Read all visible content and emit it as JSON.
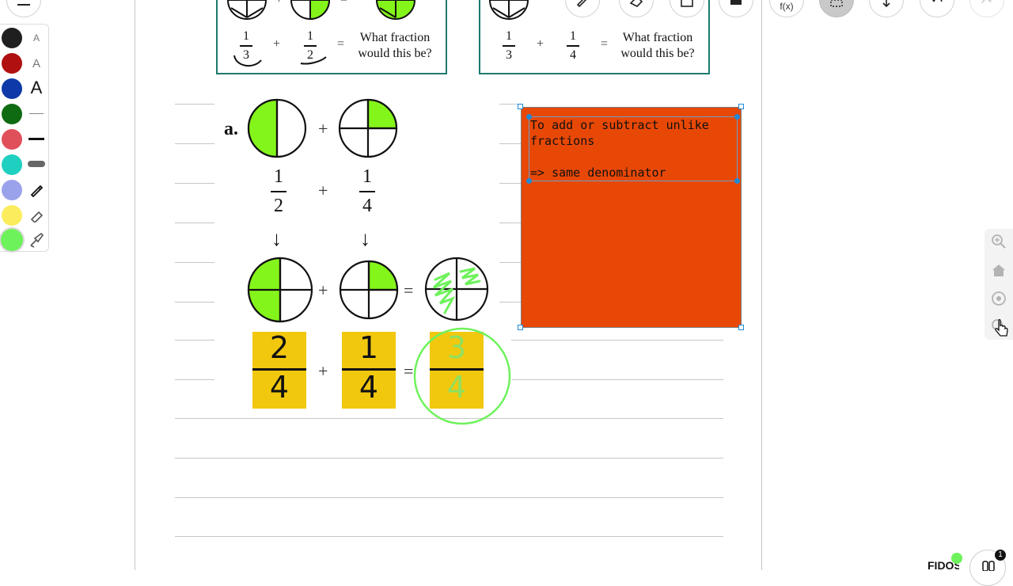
{
  "toolbar": {
    "menu_icon": "hamburger-menu-icon",
    "function_label": "f(x)"
  },
  "palette": {
    "colors": [
      "#1f1f1f",
      "#b01010",
      "#0d3aa8",
      "#0f6b12",
      "#e0505a",
      "#1fd0c0",
      "#9aa2ec",
      "#fbec5d",
      "#6ef25c"
    ],
    "text_sizes": [
      "A",
      "A",
      "A"
    ]
  },
  "worksheet": {
    "box_left": {
      "num1": "1",
      "den1": "3",
      "op": "+",
      "num2": "1",
      "den2": "2",
      "eq": "=",
      "question_line1": "What fraction",
      "question_line2": "would this be?"
    },
    "box_right": {
      "num1": "1",
      "den1": "3",
      "op": "+",
      "num2": "1",
      "den2": "4",
      "eq": "=",
      "question_line1": "What fraction",
      "question_line2": "would this be?"
    },
    "problem": {
      "label": "a.",
      "plus": "+",
      "equals": "=",
      "arrow": "↓",
      "frac1_num": "1",
      "frac1_den": "2",
      "frac2_num": "1",
      "frac2_den": "4",
      "hw1_num": "2",
      "hw1_den": "4",
      "hw2_num": "1",
      "hw2_den": "4",
      "hw3_num": "3",
      "hw3_den": "4"
    },
    "shade_color": "#84f51a",
    "highlight_color": "#f2c80f",
    "ink_green": "#6ef25c"
  },
  "note": {
    "text": "To add or subtract unlike\nfractions\n\n=> same denominator",
    "color": "#e84806"
  },
  "badge": {
    "brand": "FIDOS",
    "count": "1"
  }
}
